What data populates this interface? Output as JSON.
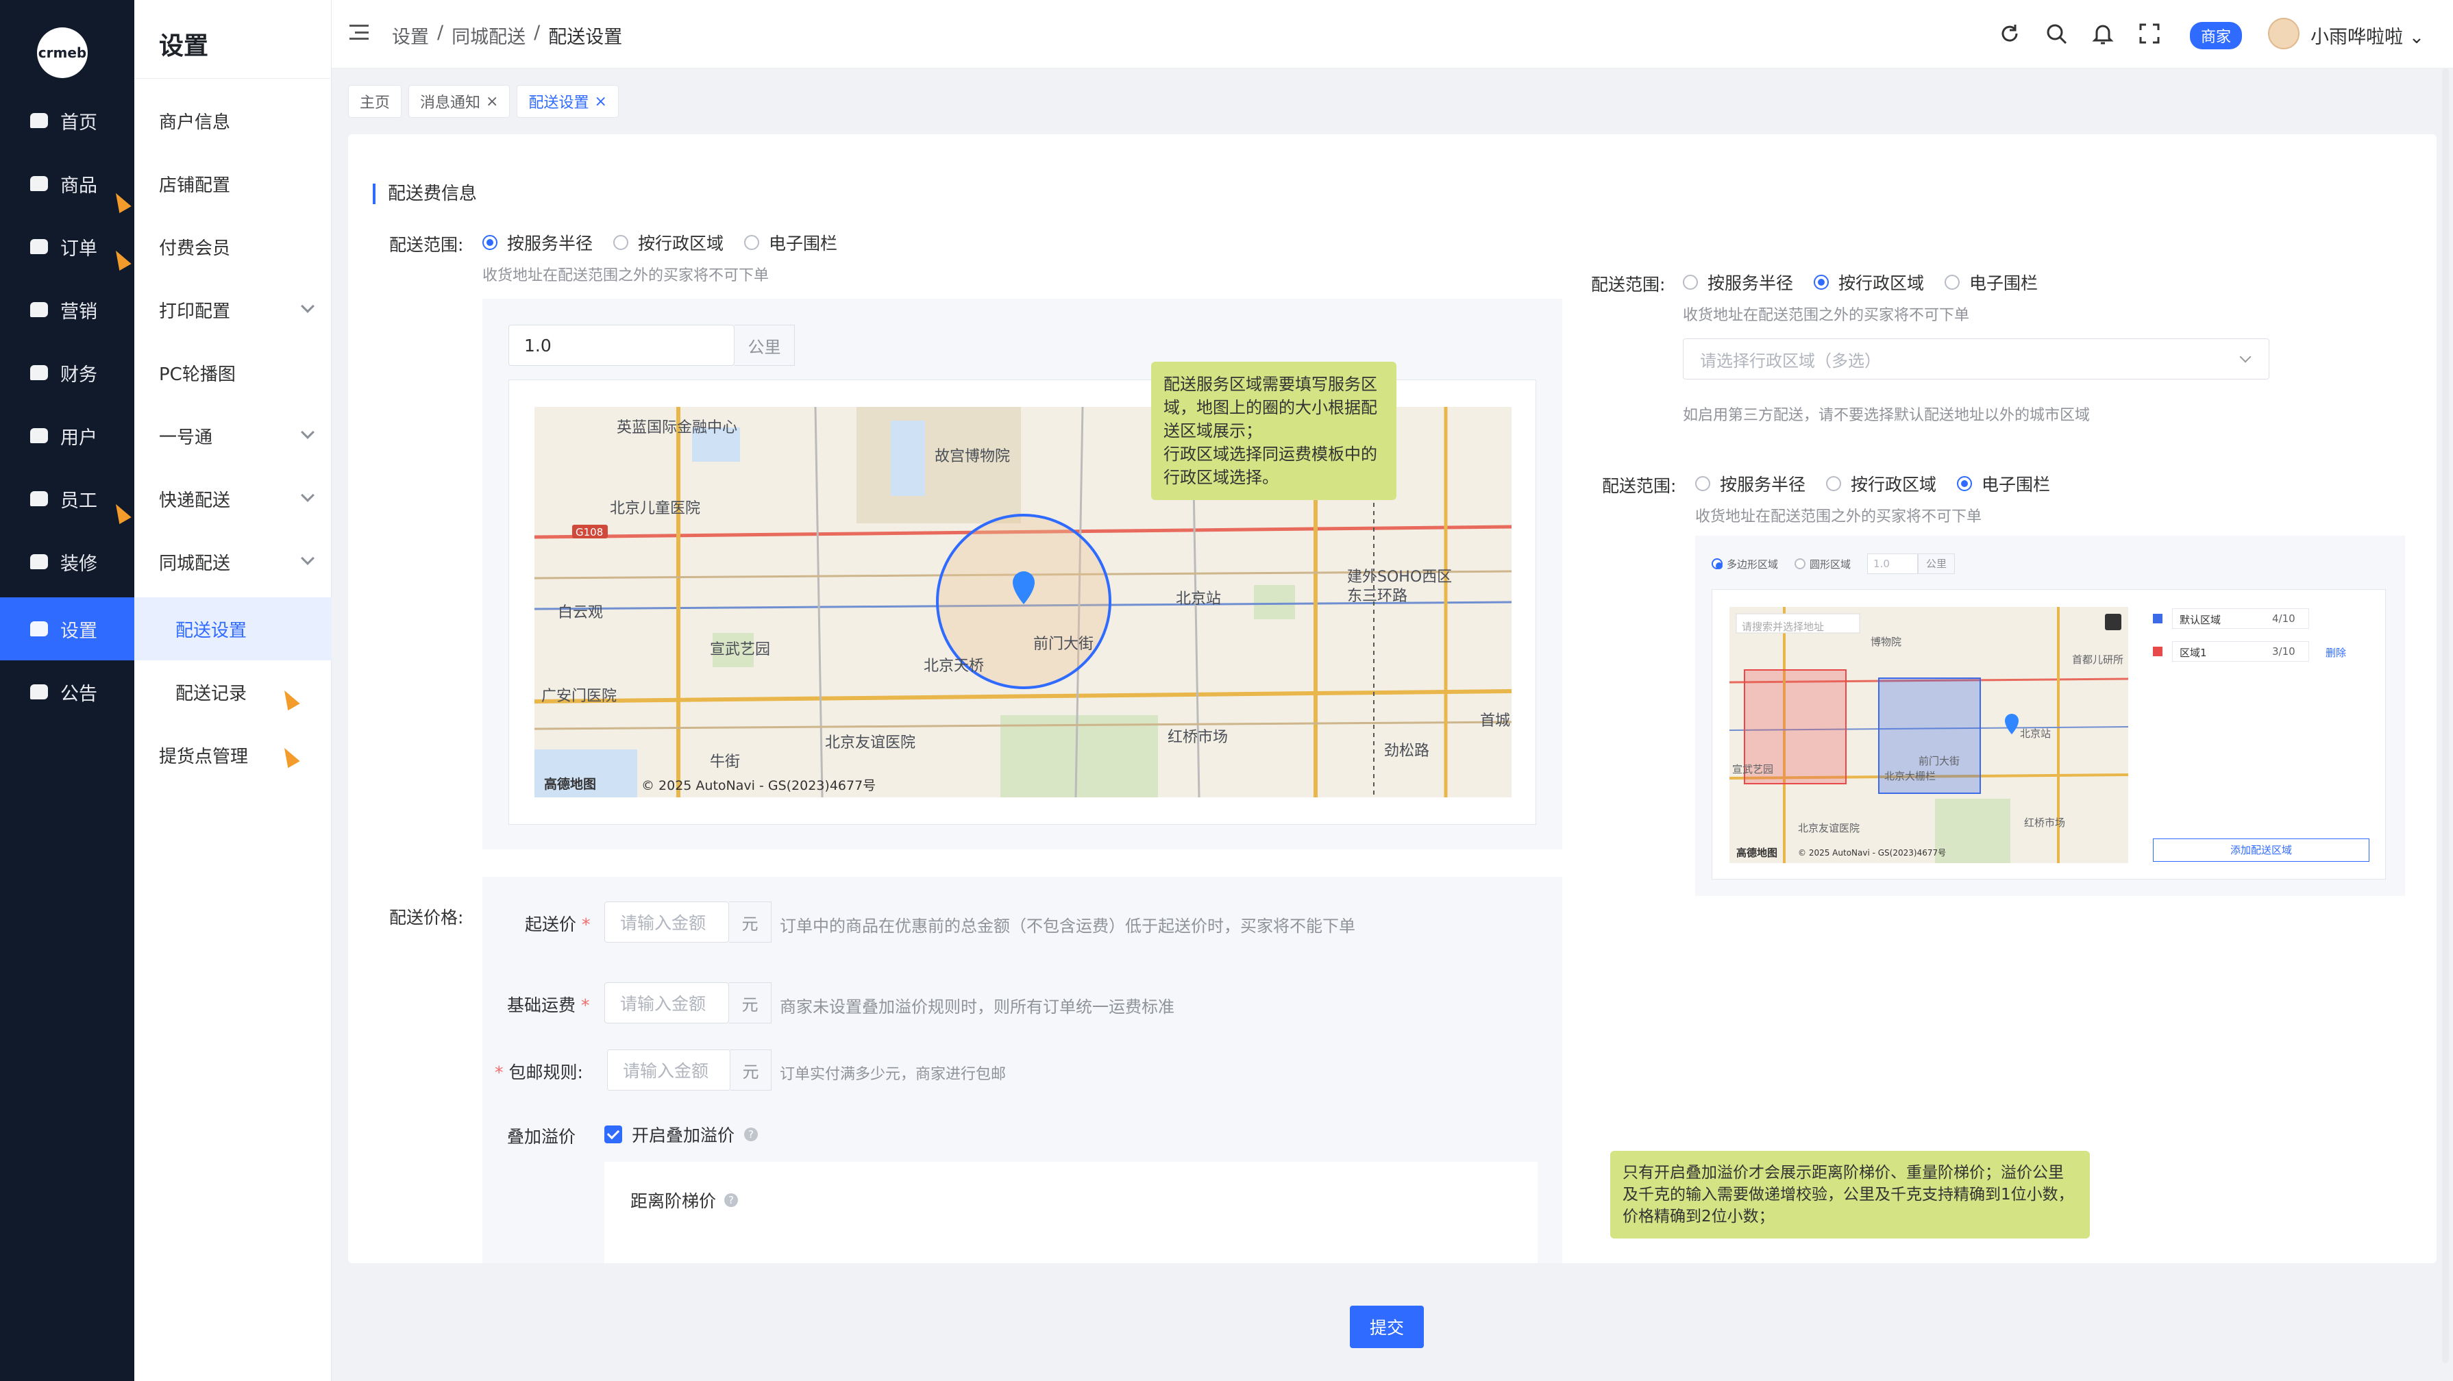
{
  "app": {
    "logo_text": "crmeb"
  },
  "rail": {
    "items": [
      {
        "label": "首页"
      },
      {
        "label": "商品"
      },
      {
        "label": "订单"
      },
      {
        "label": "营销"
      },
      {
        "label": "财务"
      },
      {
        "label": "用户"
      },
      {
        "label": "员工"
      },
      {
        "label": "装修"
      },
      {
        "label": "设置"
      },
      {
        "label": "公告"
      }
    ],
    "active_color": "#2f6bff",
    "bg_color": "#111a2b"
  },
  "submenu": {
    "title": "设置",
    "items": [
      {
        "label": "商户信息"
      },
      {
        "label": "店铺配置"
      },
      {
        "label": "付费会员"
      },
      {
        "label": "打印配置"
      },
      {
        "label": "PC轮播图"
      },
      {
        "label": "一号通"
      },
      {
        "label": "快递配送"
      },
      {
        "label": "同城配送"
      },
      {
        "label": "配送设置"
      },
      {
        "label": "配送记录"
      },
      {
        "label": "提货点管理"
      }
    ]
  },
  "header": {
    "breadcrumb": [
      "设置",
      "/",
      "同城配送",
      "/",
      "配送设置"
    ],
    "merchant_badge": "商家",
    "username": "小雨哗啦啦",
    "icons": [
      "refresh-icon",
      "search-icon",
      "bell-icon",
      "fullscreen-icon"
    ]
  },
  "tabs": [
    {
      "label": "主页",
      "closable": false
    },
    {
      "label": "消息通知",
      "closable": true
    },
    {
      "label": "配送设置",
      "closable": true,
      "active": true
    }
  ],
  "form": {
    "section_title": "配送费信息",
    "scope": {
      "label": "配送范围:",
      "options": [
        "按服务半径",
        "按行政区域",
        "电子围栏"
      ],
      "selected": "按服务半径",
      "hint": "收货地址在配送范围之外的买家将不可下单"
    },
    "radius": {
      "value": "1.0",
      "unit": "公里"
    },
    "map": {
      "labels": [
        "英蓝国际金融中心",
        "故宫博物院",
        "北京儿童医院",
        "白云观",
        "宣武艺园",
        "广安门医院",
        "北京站",
        "建外SOHO西区",
        "东三环路",
        "前门大街",
        "北京友谊医院",
        "红桥市场",
        "劲松路",
        "首城",
        "牛街",
        "北京天桥"
      ],
      "road_badge": "G108",
      "brand": "高德地图",
      "copyright": "© 2025 AutoNavi - GS(2023)4677号"
    },
    "tooltip_map": "配送服务区域需要填写服务区域，地图上的圈的大小根据配送区域展示；\n行政区域选择同运费模板中的行政区域选择。",
    "price": {
      "label": "配送价格:",
      "rows": [
        {
          "label": "起送价",
          "placeholder": "请输入金额",
          "unit": "元",
          "hint": "订单中的商品在优惠前的总金额（不包含运费）低于起送价时，买家将不能下单"
        },
        {
          "label": "基础运费",
          "placeholder": "请输入金额",
          "unit": "元",
          "hint": "商家未设置叠加溢价规则时，则所有订单统一运费标准"
        },
        {
          "label": "包邮规则:",
          "placeholder": "请输入金额",
          "unit": "元",
          "hint": "订单实付满多少元，商家进行包邮"
        }
      ],
      "markup_label": "叠加溢价",
      "markup_checkbox": "开启叠加溢价",
      "distance_tier": "距离阶梯价"
    },
    "tooltip_markup": "只有开启叠加溢价才会展示距离阶梯价、重量阶梯价；溢价公里及千克的输入需要做递增校验，公里及千克支持精确到1位小数，价格精确到2位小数；"
  },
  "right_admin": {
    "label": "配送范围:",
    "options": [
      "按服务半径",
      "按行政区域",
      "电子围栏"
    ],
    "selected": "按行政区域",
    "hint": "收货地址在配送范围之外的买家将不可下单",
    "select_placeholder": "请选择行政区域（多选）",
    "note": "如启用第三方配送，请不要选择默认配送地址以外的城市区域"
  },
  "right_fence": {
    "label": "配送范围:",
    "options": [
      "按服务半径",
      "按行政区域",
      "电子围栏"
    ],
    "selected": "电子围栏",
    "hint": "收货地址在配送范围之外的买家将不可下单",
    "mini": {
      "opt1": "多边形区域",
      "opt2": "圆形区域",
      "radius": "1.0",
      "unit": "公里",
      "search_ph": "请搜索并选择地址",
      "zones": [
        {
          "name": "默认区域",
          "count": "4/10",
          "color": "#3d6be8"
        },
        {
          "name": "区域1",
          "count": "3/10",
          "color": "#e84a4a",
          "action": "删除"
        }
      ],
      "add_btn": "添加配送区域",
      "map_labels": [
        "北京站",
        "前门大街",
        "北京大栅栏",
        "北京友谊医院",
        "红桥市场",
        "宣武艺园",
        "首都儿研所",
        "博物院"
      ],
      "brand": "高德地图",
      "copyright": "© 2025 AutoNavi - GS(2023)4677号"
    }
  },
  "submit": "提交"
}
